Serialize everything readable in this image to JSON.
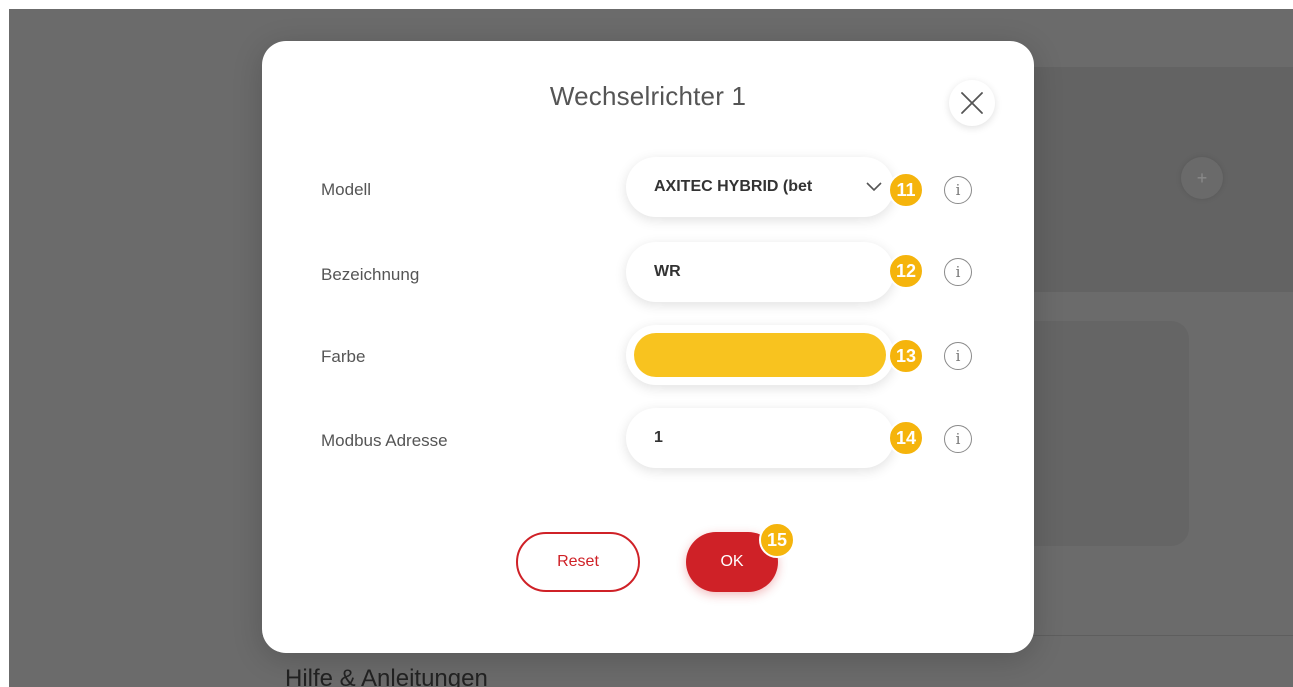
{
  "background": {
    "section_heading": "Hilfe & Anleitungen",
    "plus_label": "+"
  },
  "dialog": {
    "title": "Wechselrichter 1",
    "fields": {
      "model": {
        "label": "Modell",
        "value": "AXITEC HYBRID (bet",
        "badge": "11"
      },
      "name": {
        "label": "Bezeichnung",
        "value": "WR",
        "badge": "12"
      },
      "color": {
        "label": "Farbe",
        "value_color": "#f8c31f",
        "badge": "13"
      },
      "modbus": {
        "label": "Modbus Adresse",
        "value": "1",
        "badge": "14"
      }
    },
    "info_symbol": "i",
    "buttons": {
      "reset": "Reset",
      "ok": "OK",
      "ok_badge": "15"
    }
  },
  "colors": {
    "accent_red": "#cf2127",
    "badge_orange": "#f5b40c",
    "overlay": "#6b6b6b"
  }
}
